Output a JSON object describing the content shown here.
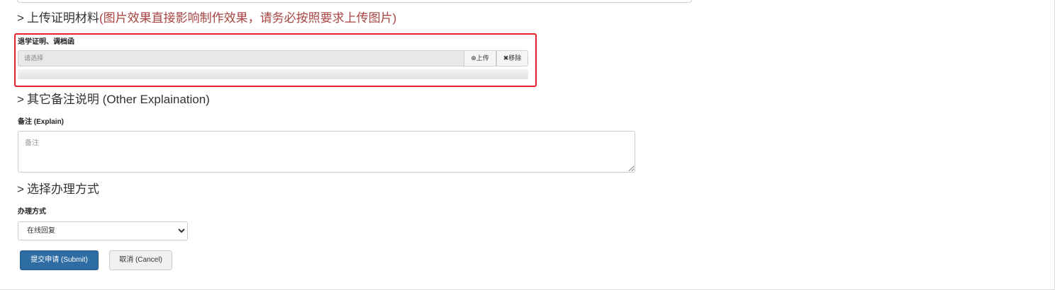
{
  "upload_section": {
    "chevron": ">",
    "title": "上传证明材料",
    "warning": "(图片效果直接影响制作效果，请务必按照要求上传图片)",
    "field_label": "退学证明、调档函",
    "file_placeholder": "请选择",
    "upload_icon": "⊕",
    "upload_label": "上传",
    "remove_icon": "✖",
    "remove_label": "移除",
    "upload_progress": 0
  },
  "remarks_section": {
    "chevron": ">",
    "title": "其它备注说明 (Other Explaination)",
    "field_label": "备注 (Explain)",
    "placeholder": "备注",
    "value": ""
  },
  "method_section": {
    "chevron": ">",
    "title": "选择办理方式",
    "field_label": "办理方式",
    "selected": "在线回复"
  },
  "actions": {
    "submit_label": "提交申请 (Submit)",
    "cancel_label": "取消 (Cancel)"
  },
  "colors": {
    "warning_text": "#a94442",
    "highlight_border": "#e3232b",
    "primary_button": "#2e6da4"
  }
}
